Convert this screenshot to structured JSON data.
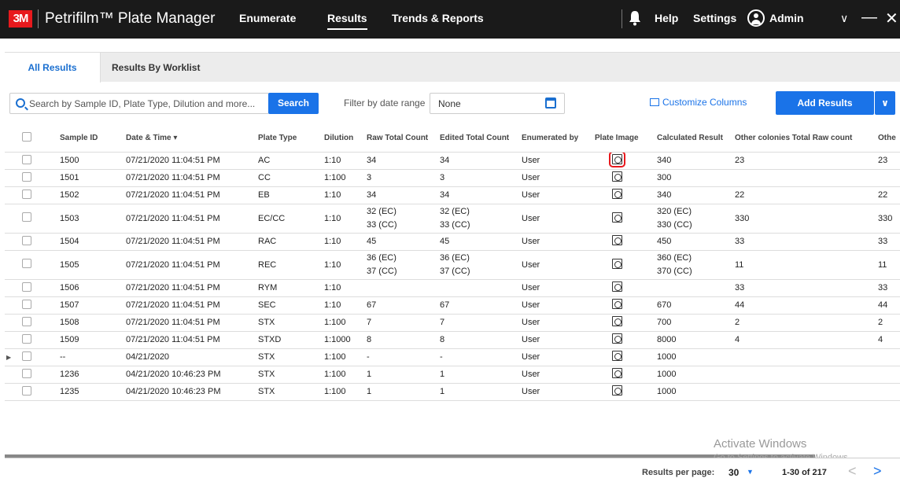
{
  "app": {
    "logo": "3M",
    "title": "Petrifilm™ Plate Manager"
  },
  "nav": {
    "enumerate": "Enumerate",
    "results": "Results",
    "trends": "Trends & Reports"
  },
  "header": {
    "help": "Help",
    "settings": "Settings",
    "user": "Admin"
  },
  "tabs": {
    "all": "All Results",
    "worklist": "Results By Worklist"
  },
  "toolbar": {
    "search_placeholder": "Search by Sample ID, Plate Type, Dilution and more...",
    "search_button": "Search",
    "filter_label": "Filter by date range",
    "date_value": "None",
    "customize": "Customize Columns",
    "add_results": "Add Results"
  },
  "columns": [
    "Sample ID",
    "Date & Time ▾",
    "Plate Type",
    "Dilution",
    "Raw Total Count",
    "Edited Total Count",
    "Enumerated by",
    "Plate Image",
    "Calculated Result",
    "Other colonies Total Raw count",
    "Othe"
  ],
  "rows": [
    {
      "id": "1500",
      "date": "07/21/2020 11:04:51 PM",
      "type": "AC",
      "dil": "1:10",
      "raw": [
        "34"
      ],
      "edited": [
        "34"
      ],
      "by": "User",
      "calc": [
        "340"
      ],
      "other": "23",
      "othe": "23"
    },
    {
      "id": "1501",
      "date": "07/21/2020 11:04:51 PM",
      "type": "CC",
      "dil": "1:100",
      "raw": [
        "3"
      ],
      "edited": [
        "3"
      ],
      "by": "User",
      "calc": [
        "300"
      ],
      "other": "",
      "othe": ""
    },
    {
      "id": "1502",
      "date": "07/21/2020 11:04:51 PM",
      "type": "EB",
      "dil": "1:10",
      "raw": [
        "34"
      ],
      "edited": [
        "34"
      ],
      "by": "User",
      "calc": [
        "340"
      ],
      "other": "22",
      "othe": "22"
    },
    {
      "id": "1503",
      "date": "07/21/2020 11:04:51 PM",
      "type": "EC/CC",
      "dil": "1:10",
      "raw": [
        "32 (EC)",
        "33 (CC)"
      ],
      "edited": [
        "32 (EC)",
        "33 (CC)"
      ],
      "by": "User",
      "calc": [
        "320 (EC)",
        "330 (CC)"
      ],
      "other": "330",
      "othe": "330"
    },
    {
      "id": "1504",
      "date": "07/21/2020 11:04:51 PM",
      "type": "RAC",
      "dil": "1:10",
      "raw": [
        "45"
      ],
      "edited": [
        "45"
      ],
      "by": "User",
      "calc": [
        "450"
      ],
      "other": "33",
      "othe": "33"
    },
    {
      "id": "1505",
      "date": "07/21/2020 11:04:51 PM",
      "type": "REC",
      "dil": "1:10",
      "raw": [
        "36 (EC)",
        "37 (CC)"
      ],
      "edited": [
        "36 (EC)",
        "37 (CC)"
      ],
      "by": "User",
      "calc": [
        "360 (EC)",
        "370 (CC)"
      ],
      "other": "11",
      "othe": "11"
    },
    {
      "id": "1506",
      "date": "07/21/2020 11:04:51 PM",
      "type": "RYM",
      "dil": "1:10",
      "raw": [
        ""
      ],
      "edited": [
        ""
      ],
      "by": "User",
      "calc": [
        ""
      ],
      "other": "33",
      "othe": "33"
    },
    {
      "id": "1507",
      "date": "07/21/2020 11:04:51 PM",
      "type": "SEC",
      "dil": "1:10",
      "raw": [
        "67"
      ],
      "edited": [
        "67"
      ],
      "by": "User",
      "calc": [
        "670"
      ],
      "other": "44",
      "othe": "44"
    },
    {
      "id": "1508",
      "date": "07/21/2020 11:04:51 PM",
      "type": "STX",
      "dil": "1:100",
      "raw": [
        "7"
      ],
      "edited": [
        "7"
      ],
      "by": "User",
      "calc": [
        "700"
      ],
      "other": "2",
      "othe": "2"
    },
    {
      "id": "1509",
      "date": "07/21/2020 11:04:51 PM",
      "type": "STXD",
      "dil": "1:1000",
      "raw": [
        "8"
      ],
      "edited": [
        "8"
      ],
      "by": "User",
      "calc": [
        "8000"
      ],
      "other": "4",
      "othe": "4"
    },
    {
      "id": "--",
      "date": "04/21/2020",
      "type": "STX",
      "dil": "1:100",
      "raw": [
        "-"
      ],
      "edited": [
        "-"
      ],
      "by": "User",
      "calc": [
        "1000"
      ],
      "other": "",
      "othe": ""
    },
    {
      "id": "1236",
      "date": "04/21/2020 10:46:23 PM",
      "type": "STX",
      "dil": "1:100",
      "raw": [
        "1"
      ],
      "edited": [
        "1"
      ],
      "by": "User",
      "calc": [
        "1000"
      ],
      "other": "",
      "othe": ""
    },
    {
      "id": "1235",
      "date": "04/21/2020 10:46:23 PM",
      "type": "STX",
      "dil": "1:100",
      "raw": [
        "1"
      ],
      "edited": [
        "1"
      ],
      "by": "User",
      "calc": [
        "1000"
      ],
      "other": "",
      "othe": ""
    }
  ],
  "footer": {
    "per_page_label": "Results per page:",
    "per_page": "30",
    "range": "1-30 of 217"
  },
  "watermark": {
    "title": "Activate Windows",
    "sub": "Go to Settings to activate Windows."
  },
  "colors": {
    "accent": "#1a73e8",
    "brand": "#e8191d",
    "topbar": "#1a1a1a"
  }
}
